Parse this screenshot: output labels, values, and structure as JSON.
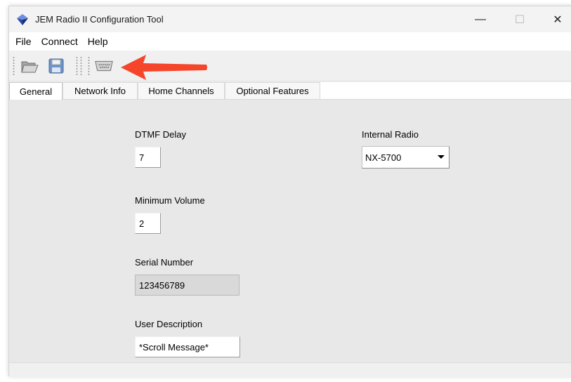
{
  "window": {
    "title": "JEM Radio II Configuration Tool",
    "controls": {
      "minimize": "—",
      "maximize": "☐",
      "close": "✕"
    }
  },
  "menu": {
    "items": [
      "File",
      "Connect",
      "Help"
    ]
  },
  "toolbar": {
    "buttons": [
      {
        "name": "open-folder",
        "icon": "folder-icon"
      },
      {
        "name": "save",
        "icon": "floppy-disk-icon"
      },
      {
        "name": "connect",
        "icon": "serial-port-icon"
      }
    ],
    "annotation_arrow_color": "#f5452a"
  },
  "tabs": [
    "General",
    "Network Info",
    "Home Channels",
    "Optional Features"
  ],
  "active_tab": "General",
  "general": {
    "dtmf_delay": {
      "label": "DTMF Delay",
      "value": "7"
    },
    "minimum_volume": {
      "label": "Minimum Volume",
      "value": "2"
    },
    "serial_number": {
      "label": "Serial Number",
      "value": "123456789"
    },
    "user_description": {
      "label": "User Description",
      "value": "*Scroll Message*"
    },
    "internal_radio": {
      "label": "Internal Radio",
      "value": "NX-5700"
    }
  },
  "colors": {
    "panel_bg": "#e8e8e8",
    "window_bg": "#f0f0f0",
    "app_icon_blue": "#2e4aa8",
    "arrow": "#f5452a"
  }
}
